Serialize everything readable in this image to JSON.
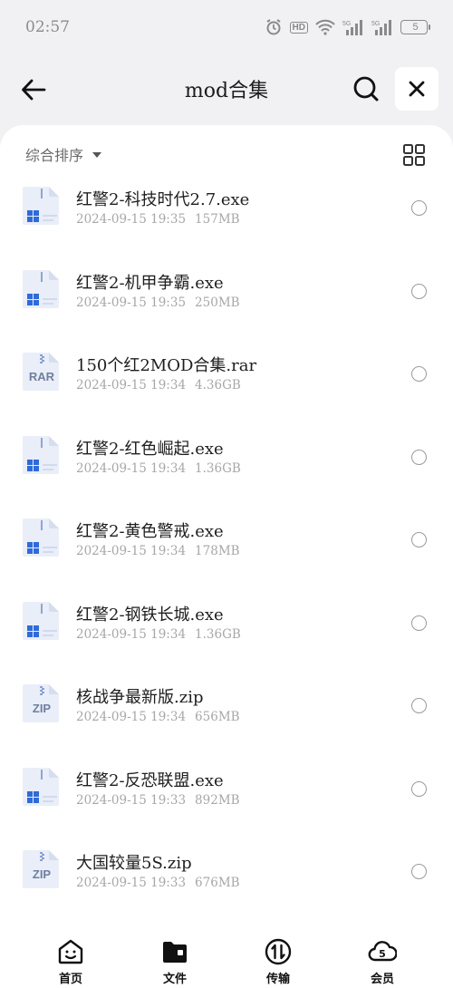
{
  "status_bar": {
    "time": "02:57",
    "hd_label": "HD",
    "signal1_label": "5G",
    "signal2_label": "5G",
    "battery": "5"
  },
  "header": {
    "title": "mod合集"
  },
  "toolbar": {
    "sort_label": "综合排序"
  },
  "files": [
    {
      "name": "红警2-科技时代2.7.exe",
      "date": "2024-09-15 19:35",
      "size": "157MB",
      "type": "exe"
    },
    {
      "name": "红警2-机甲争霸.exe",
      "date": "2024-09-15 19:35",
      "size": "250MB",
      "type": "exe"
    },
    {
      "name": "150个红2MOD合集.rar",
      "date": "2024-09-15 19:34",
      "size": "4.36GB",
      "type": "rar",
      "badge": "RAR"
    },
    {
      "name": "红警2-红色崛起.exe",
      "date": "2024-09-15 19:34",
      "size": "1.36GB",
      "type": "exe"
    },
    {
      "name": "红警2-黄色警戒.exe",
      "date": "2024-09-15 19:34",
      "size": "178MB",
      "type": "exe"
    },
    {
      "name": "红警2-钢铁长城.exe",
      "date": "2024-09-15 19:34",
      "size": "1.36GB",
      "type": "exe"
    },
    {
      "name": "核战争最新版.zip",
      "date": "2024-09-15 19:34",
      "size": "656MB",
      "type": "zip",
      "badge": "ZIP"
    },
    {
      "name": "红警2-反恐联盟.exe",
      "date": "2024-09-15 19:33",
      "size": "892MB",
      "type": "exe"
    },
    {
      "name": "大国较量5S.zip",
      "date": "2024-09-15 19:33",
      "size": "676MB",
      "type": "zip",
      "badge": "ZIP"
    }
  ],
  "bottom_nav": {
    "home": "首页",
    "files": "文件",
    "transfer": "传输",
    "member": "会员"
  },
  "colors": {
    "accent": "#0a5ff0",
    "background": "#f1f1f3",
    "icon_tile": "#e9eef8"
  }
}
